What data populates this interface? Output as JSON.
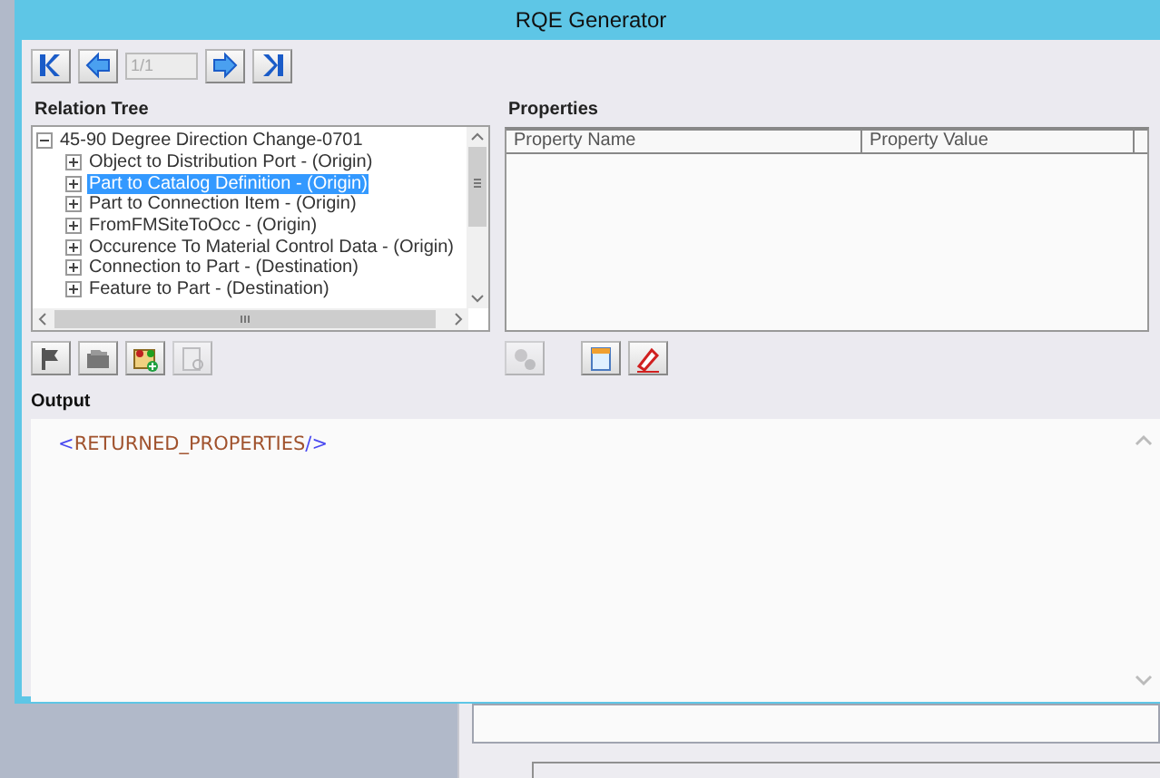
{
  "window": {
    "title": "RQE Generator"
  },
  "navigation": {
    "page": "1/1"
  },
  "relation_tree": {
    "label": "Relation Tree",
    "root": {
      "label": "45-90 Degree Direction Change-0701",
      "expanded": true,
      "selected": false,
      "children": [
        {
          "label": "Object to Distribution Port - (Origin)",
          "expanded": false,
          "selected": false
        },
        {
          "label": "Part to Catalog Definition - (Origin)",
          "expanded": false,
          "selected": true
        },
        {
          "label": "Part to Connection Item - (Origin)",
          "expanded": false,
          "selected": false
        },
        {
          "label": "FromFMSiteToOcc - (Origin)",
          "expanded": false,
          "selected": false
        },
        {
          "label": "Occurence To Material Control Data - (Origin)",
          "expanded": false,
          "selected": false
        },
        {
          "label": "Connection to Part - (Destination)",
          "expanded": false,
          "selected": false
        },
        {
          "label": "Feature to Part - (Destination)",
          "expanded": false,
          "selected": false
        }
      ]
    }
  },
  "properties": {
    "label": "Properties",
    "columns": [
      "Property Name",
      "Property Value"
    ]
  },
  "output": {
    "label": "Output",
    "text": "<RETURNED_PROPERTIES/>"
  }
}
